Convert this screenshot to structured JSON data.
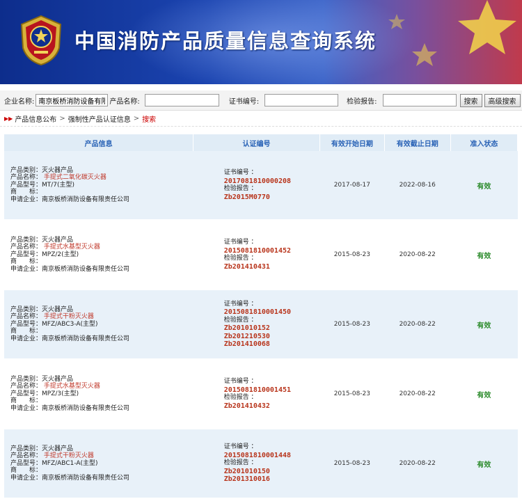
{
  "banner": {
    "title": "中国消防产品质量信息查询系统"
  },
  "search": {
    "company_label": "企业名称:",
    "company_value": "南京板桥消防设备有限",
    "product_label": "产品名称:",
    "cert_label": "证书编号:",
    "report_label": "检验报告:",
    "search_button": "搜索",
    "advanced_button": "高级搜索"
  },
  "breadcrumb": {
    "item1": "产品信息公布",
    "sep": ">",
    "item2": "强制性产品认证信息",
    "current": "搜索"
  },
  "table": {
    "headers": {
      "product": "产品信息",
      "cert": "认证编号",
      "start": "有效开始日期",
      "end": "有效截止日期",
      "status": "准入状态"
    },
    "labels": {
      "category": "产品类别：",
      "name": "产品名称：",
      "model": "产品型号：",
      "brand": "商　　标：",
      "company": "申请企业：",
      "cert_no": "证书编号 ：",
      "report": "检验报告 ："
    },
    "rows": [
      {
        "category": "灭火器产品",
        "name": "手提式二氧化碳灭火器",
        "model": "MT/7(主型)",
        "brand": "",
        "company": "南京板桥消防设备有限责任公司",
        "cert_no": "2017081810000208",
        "reports": [
          "Zb2015M0770"
        ],
        "start": "2017-08-17",
        "end": "2022-08-16",
        "status": "有效"
      },
      {
        "category": "灭火器产品",
        "name": "手提式水基型灭火器",
        "model": "MPZ/2(主型)",
        "brand": "",
        "company": "南京板桥消防设备有限责任公司",
        "cert_no": "2015081810001452",
        "reports": [
          "Zb201410431"
        ],
        "start": "2015-08-23",
        "end": "2020-08-22",
        "status": "有效"
      },
      {
        "category": "灭火器产品",
        "name": "手提式干粉灭火器",
        "model": "MFZ/ABC3-A(主型)",
        "brand": "",
        "company": "南京板桥消防设备有限责任公司",
        "cert_no": "2015081810001450",
        "reports": [
          "Zb201010152",
          "Zb201210530",
          "Zb201410068"
        ],
        "start": "2015-08-23",
        "end": "2020-08-22",
        "status": "有效"
      },
      {
        "category": "灭火器产品",
        "name": "手提式水基型灭火器",
        "model": "MPZ/3(主型)",
        "brand": "",
        "company": "南京板桥消防设备有限责任公司",
        "cert_no": "2015081810001451",
        "reports": [
          "Zb201410432"
        ],
        "start": "2015-08-23",
        "end": "2020-08-22",
        "status": "有效"
      },
      {
        "category": "灭火器产品",
        "name": "手提式干粉灭火器",
        "model": "MFZ/ABC1-A(主型)",
        "brand": "",
        "company": "南京板桥消防设备有限责任公司",
        "cert_no": "2015081810001448",
        "reports": [
          "Zb201010150",
          "Zb201310016"
        ],
        "start": "2015-08-23",
        "end": "2020-08-22",
        "status": "有效"
      }
    ]
  },
  "colors": {
    "accent_red": "#b8341b",
    "header_blue": "#2a63b6",
    "valid_green": "#2a8a2a"
  }
}
